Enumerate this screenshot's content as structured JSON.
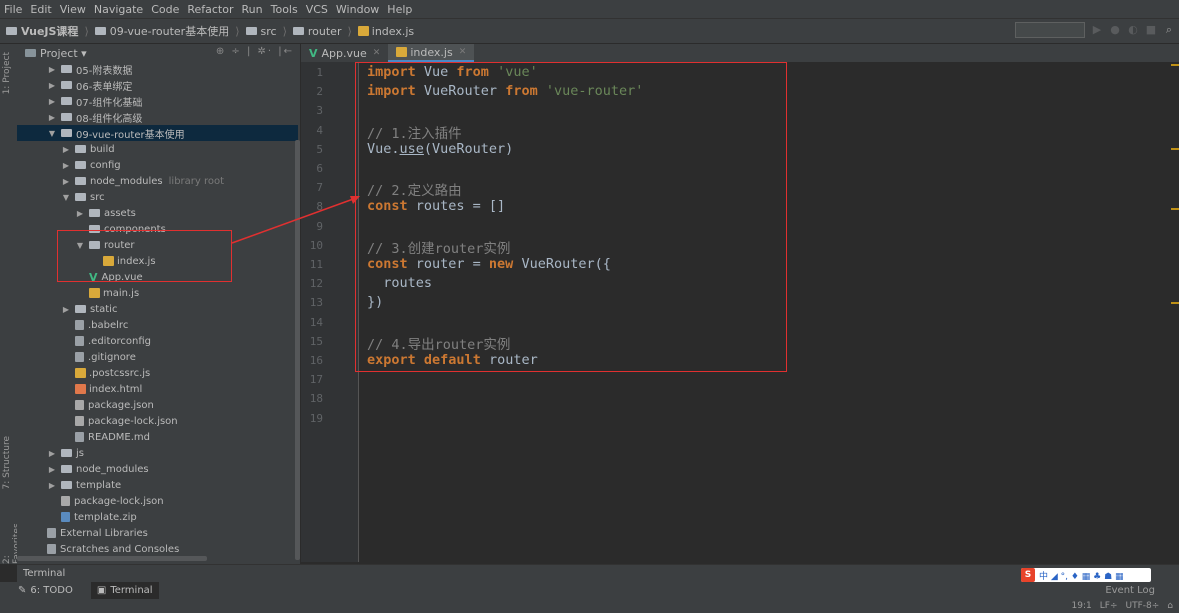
{
  "menu": [
    "File",
    "Edit",
    "View",
    "Navigate",
    "Code",
    "Refactor",
    "Run",
    "Tools",
    "VCS",
    "Window",
    "Help"
  ],
  "breadcrumb": [
    "VueJS课程",
    "09-vue-router基本使用",
    "src",
    "router",
    "index.js"
  ],
  "project_panel": {
    "title": "Project ▾",
    "tools": "⊕ ÷ | ✲· |←"
  },
  "left_strip": {
    "project": "1: Project",
    "structure": "7: Structure",
    "favorites": "2: Favorites"
  },
  "tree": [
    {
      "indent": 1,
      "arrow": "▶",
      "icon": "folder",
      "label": "05-附表数据",
      "extra": ""
    },
    {
      "indent": 1,
      "arrow": "▶",
      "icon": "folder",
      "label": "06-表单绑定",
      "extra": ""
    },
    {
      "indent": 1,
      "arrow": "▶",
      "icon": "folder",
      "label": "07-组件化基础",
      "extra": ""
    },
    {
      "indent": 1,
      "arrow": "▶",
      "icon": "folder",
      "label": "08-组件化高级",
      "extra": ""
    },
    {
      "indent": 1,
      "arrow": "▼",
      "icon": "folder",
      "label": "09-vue-router基本使用",
      "extra": "",
      "selected": true
    },
    {
      "indent": 2,
      "arrow": "▶",
      "icon": "folder",
      "label": "build",
      "extra": ""
    },
    {
      "indent": 2,
      "arrow": "▶",
      "icon": "folder",
      "label": "config",
      "extra": ""
    },
    {
      "indent": 2,
      "arrow": "▶",
      "icon": "folder",
      "label": "node_modules",
      "extra": "library root"
    },
    {
      "indent": 2,
      "arrow": "▼",
      "icon": "folder",
      "label": "src",
      "extra": ""
    },
    {
      "indent": 3,
      "arrow": "▶",
      "icon": "folder",
      "label": "assets",
      "extra": ""
    },
    {
      "indent": 3,
      "arrow": "",
      "icon": "folder",
      "label": "components",
      "extra": ""
    },
    {
      "indent": 3,
      "arrow": "▼",
      "icon": "folder",
      "label": "router",
      "extra": ""
    },
    {
      "indent": 4,
      "arrow": "",
      "icon": "js",
      "label": "index.js",
      "extra": ""
    },
    {
      "indent": 3,
      "arrow": "",
      "icon": "vue",
      "label": "App.vue",
      "extra": ""
    },
    {
      "indent": 3,
      "arrow": "",
      "icon": "js",
      "label": "main.js",
      "extra": ""
    },
    {
      "indent": 2,
      "arrow": "▶",
      "icon": "folder",
      "label": "static",
      "extra": ""
    },
    {
      "indent": 2,
      "arrow": "",
      "icon": "file",
      "label": ".babelrc",
      "extra": ""
    },
    {
      "indent": 2,
      "arrow": "",
      "icon": "file",
      "label": ".editorconfig",
      "extra": ""
    },
    {
      "indent": 2,
      "arrow": "",
      "icon": "file",
      "label": ".gitignore",
      "extra": ""
    },
    {
      "indent": 2,
      "arrow": "",
      "icon": "js",
      "label": ".postcssrc.js",
      "extra": ""
    },
    {
      "indent": 2,
      "arrow": "",
      "icon": "html",
      "label": "index.html",
      "extra": ""
    },
    {
      "indent": 2,
      "arrow": "",
      "icon": "json",
      "label": "package.json",
      "extra": ""
    },
    {
      "indent": 2,
      "arrow": "",
      "icon": "json",
      "label": "package-lock.json",
      "extra": ""
    },
    {
      "indent": 2,
      "arrow": "",
      "icon": "file",
      "label": "README.md",
      "extra": ""
    },
    {
      "indent": 1,
      "arrow": "▶",
      "icon": "folder",
      "label": "js",
      "extra": ""
    },
    {
      "indent": 1,
      "arrow": "▶",
      "icon": "folder",
      "label": "node_modules",
      "extra": ""
    },
    {
      "indent": 1,
      "arrow": "▶",
      "icon": "folder",
      "label": "template",
      "extra": ""
    },
    {
      "indent": 1,
      "arrow": "",
      "icon": "json",
      "label": "package-lock.json",
      "extra": ""
    },
    {
      "indent": 1,
      "arrow": "",
      "icon": "zip",
      "label": "template.zip",
      "extra": ""
    },
    {
      "indent": 0,
      "arrow": "",
      "icon": "lib",
      "label": "External Libraries",
      "extra": ""
    },
    {
      "indent": 0,
      "arrow": "",
      "icon": "scratch",
      "label": "Scratches and Consoles",
      "extra": ""
    }
  ],
  "tabs": [
    {
      "label": "App.vue",
      "icon": "vue",
      "active": false
    },
    {
      "label": "index.js",
      "icon": "js",
      "active": true
    }
  ],
  "code_lines": [
    [
      [
        "kw",
        "import"
      ],
      [
        "t",
        " Vue "
      ],
      [
        "kw",
        "from"
      ],
      [
        "t",
        " "
      ],
      [
        "str",
        "'vue'"
      ]
    ],
    [
      [
        "kw",
        "import"
      ],
      [
        "t",
        " VueRouter "
      ],
      [
        "kw",
        "from"
      ],
      [
        "t",
        " "
      ],
      [
        "str",
        "'vue-router'"
      ]
    ],
    [],
    [
      [
        "cm",
        "// 1.注入插件"
      ]
    ],
    [
      [
        "t",
        "Vue."
      ],
      [
        "fn",
        "use"
      ],
      [
        "t",
        "(VueRouter)"
      ]
    ],
    [],
    [
      [
        "cm",
        "// 2.定义路由"
      ]
    ],
    [
      [
        "kw",
        "const"
      ],
      [
        "t",
        " routes = []"
      ]
    ],
    [],
    [
      [
        "cm",
        "// 3.创建router实例"
      ]
    ],
    [
      [
        "kw",
        "const"
      ],
      [
        "t",
        " router = "
      ],
      [
        "kw",
        "new"
      ],
      [
        "t",
        " VueRouter({"
      ]
    ],
    [
      [
        "t",
        "  routes"
      ]
    ],
    [
      [
        "t",
        "})"
      ]
    ],
    [],
    [
      [
        "cm",
        "// 4.导出router实例"
      ]
    ],
    [
      [
        "kw",
        "export"
      ],
      [
        "t",
        " "
      ],
      [
        "kw",
        "default"
      ],
      [
        "t",
        " router"
      ]
    ],
    [],
    [],
    []
  ],
  "terminal_title": "Terminal",
  "bottom_tabs": [
    {
      "label": "6: TODO",
      "active": false
    },
    {
      "label": "Terminal",
      "active": true
    }
  ],
  "event_log": "Event Log",
  "status": {
    "position": "19:1",
    "line_sep": "LF÷",
    "encoding": "UTF-8÷"
  },
  "ime": {
    "logo": "S",
    "text": "中 ◢ °, ♦ ▦ ♣ ☗ ▦"
  },
  "colors": {
    "keyword": "#cc7832",
    "string": "#6a8759",
    "comment": "#808080",
    "annotation_red": "#e03030"
  }
}
